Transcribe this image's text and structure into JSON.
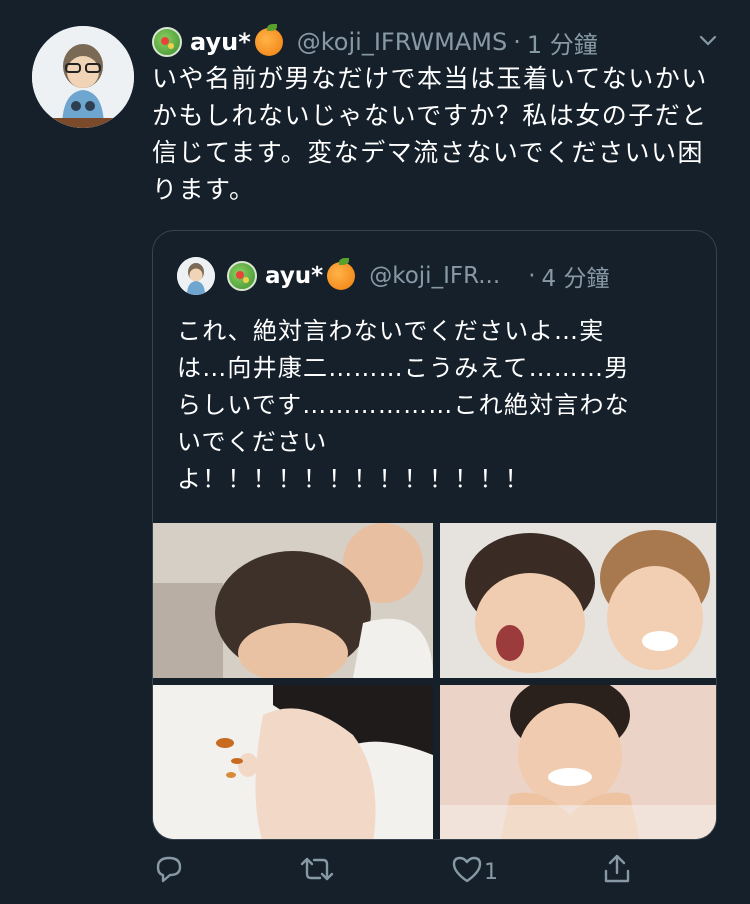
{
  "tweet": {
    "display_name": "ayu*",
    "handle": "@koji_IFRWMAMS",
    "separator": "·",
    "time": "1 分鐘",
    "text": "いや名前が男なだけで本当は玉着いてないかいかもしれないじゃないですか？私は女の子だと信じてます。変なデマ流さないでくださいい困ります。"
  },
  "quoted_tweet": {
    "display_name": "ayu*",
    "handle": "@koji_IFR...",
    "separator": "·",
    "time": "4 分鐘",
    "text_lines": [
      "これ、絶対言わないでくださいよ…実",
      "は…向井康二………こうみえて………男",
      "らしいです………………これ絶対言わな",
      "いでください",
      "よ！！！！！！！！！！！！！"
    ]
  },
  "actions": {
    "reply_icon": "reply-icon",
    "retweet_icon": "retweet-icon",
    "like_icon": "heart-icon",
    "like_count": "1",
    "share_icon": "share-icon"
  },
  "colors": {
    "background": "#15202b",
    "secondary_text": "#8899a6",
    "border": "#38444d"
  }
}
